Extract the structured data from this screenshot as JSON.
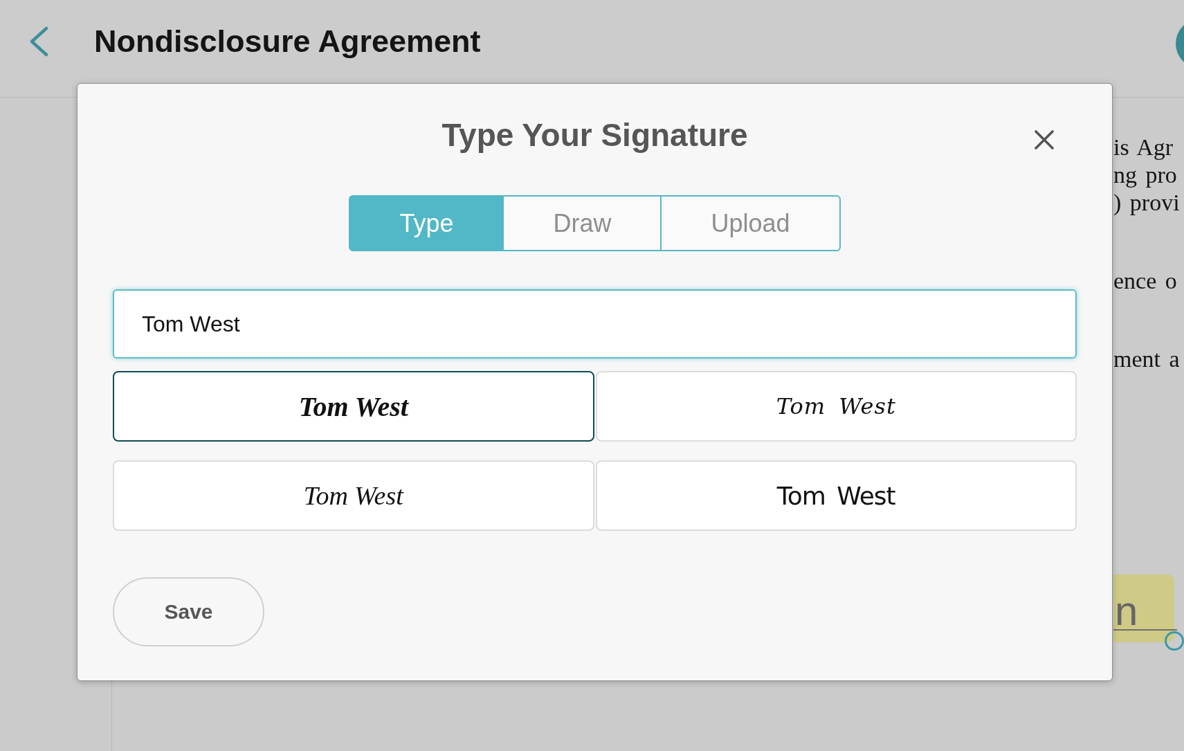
{
  "header": {
    "title": "Nondisclosure Agreement"
  },
  "document": {
    "paragraphs": [
      {
        "lines": [
          "is Agr",
          "ng pro",
          ") provi"
        ]
      },
      {
        "lines": [
          "ence o"
        ]
      },
      {
        "lines": [
          "ment a"
        ]
      }
    ],
    "signature_field": {
      "text": "n"
    }
  },
  "dialog": {
    "title": "Type Your Signature",
    "tabs": [
      {
        "label": "Type",
        "selected": true
      },
      {
        "label": "Draw",
        "selected": false
      },
      {
        "label": "Upload",
        "selected": false
      }
    ],
    "name_field": {
      "value": "Tom West"
    },
    "signature_options": [
      {
        "text": "Tom West",
        "kind": "bold",
        "selected": true
      },
      {
        "text": "Tom West",
        "kind": "flowing",
        "selected": false
      },
      {
        "text": "Tom West",
        "kind": "slanted",
        "selected": false
      },
      {
        "text": "Tom West",
        "kind": "print",
        "selected": false
      }
    ],
    "save_button": {
      "label": "Save"
    }
  }
}
